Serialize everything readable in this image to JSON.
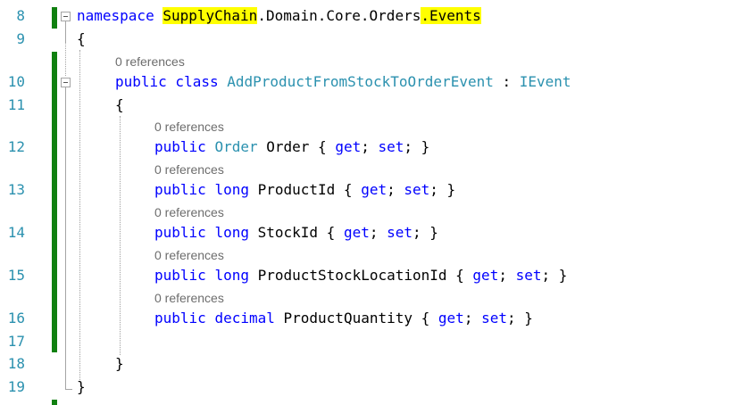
{
  "editor": {
    "line_numbers": [
      "8",
      "9",
      "10",
      "11",
      "12",
      "13",
      "14",
      "15",
      "16",
      "17",
      "18",
      "19"
    ],
    "references_label": "0 references",
    "namespace_line": {
      "keyword": "namespace",
      "seg1": "SupplyChain",
      "seg2": ".Domain.Core.Orders",
      "seg3": ".Events"
    },
    "open_brace": "{",
    "close_brace": "}",
    "class_line": {
      "mods": "public class",
      "name": "AddProductFromStockToOrderEvent",
      "colon": " : ",
      "base": "IEvent"
    },
    "properties": [
      {
        "mod": "public",
        "type": "Order",
        "name": " Order { ",
        "get": "get",
        "sep": "; ",
        "set": "set",
        "end": "; }"
      },
      {
        "mod": "public",
        "type": "long",
        "name": " ProductId { ",
        "get": "get",
        "sep": "; ",
        "set": "set",
        "end": "; }"
      },
      {
        "mod": "public",
        "type": "long",
        "name": " StockId { ",
        "get": "get",
        "sep": "; ",
        "set": "set",
        "end": "; }"
      },
      {
        "mod": "public",
        "type": "long",
        "name": " ProductStockLocationId { ",
        "get": "get",
        "sep": "; ",
        "set": "set",
        "end": "; }"
      },
      {
        "mod": "public",
        "type": "decimal",
        "name": " ProductQuantity { ",
        "get": "get",
        "sep": "; ",
        "set": "set",
        "end": "; }"
      }
    ]
  },
  "colors": {
    "keyword": "#0000ff",
    "type": "#2b91af",
    "highlight": "#ffff00",
    "change_bar": "#108010",
    "codelens": "#6d6d6d"
  }
}
